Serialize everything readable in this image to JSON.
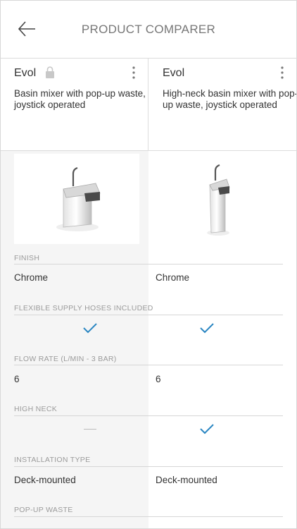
{
  "header": {
    "title": "PRODUCT COMPARER",
    "back_icon": "arrow-left-icon"
  },
  "products": [
    {
      "name": "Evol",
      "description": "Basin mixer with pop-up waste, joystick operated",
      "locked": true
    },
    {
      "name": "Evol",
      "description": "High-neck basin mixer with pop-up waste, joystick operated",
      "locked": false
    }
  ],
  "specs": [
    {
      "label": "FINISH",
      "values": [
        "Chrome",
        "Chrome"
      ]
    },
    {
      "label": "FLEXIBLE SUPPLY HOSES INCLUDED",
      "values": [
        "check",
        "check"
      ]
    },
    {
      "label": "FLOW RATE (L/MIN - 3 BAR)",
      "values": [
        "6",
        "6"
      ]
    },
    {
      "label": "HIGH NECK",
      "values": [
        "dash",
        "check"
      ]
    },
    {
      "label": "INSTALLATION TYPE",
      "values": [
        "Deck-mounted",
        "Deck-mounted"
      ]
    },
    {
      "label": "POP-UP WASTE",
      "values": []
    }
  ],
  "colors": {
    "accent": "#2a86c2",
    "divider": "#d6d6d6",
    "label": "#9b9b9b"
  }
}
